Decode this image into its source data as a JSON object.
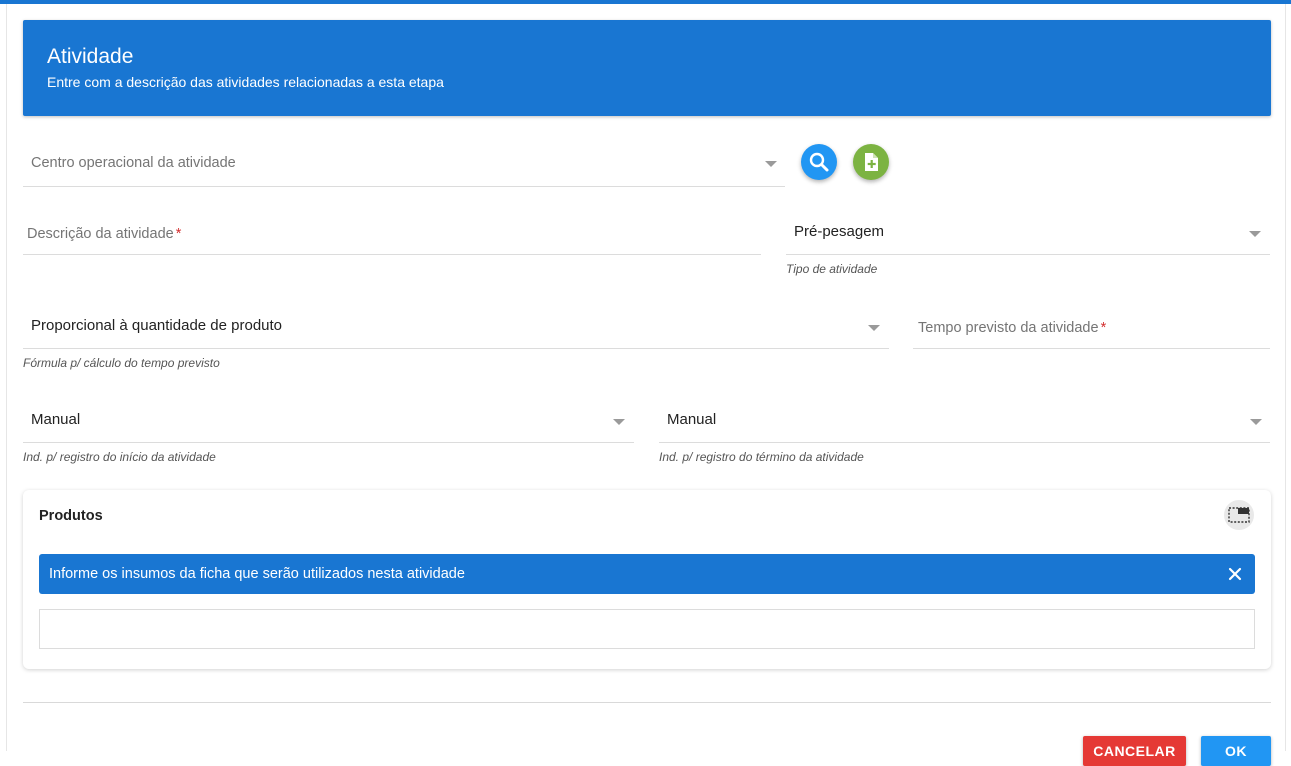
{
  "header": {
    "title": "Atividade",
    "subtitle": "Entre com a descrição das atividades relacionadas a esta etapa"
  },
  "fields": {
    "centro_operacional": {
      "placeholder": "Centro operacional da atividade"
    },
    "descricao": {
      "placeholder": "Descrição da atividade",
      "required_mark": "*"
    },
    "tipo_atividade": {
      "value": "Pré-pesagem",
      "hint": "Tipo de atividade"
    },
    "formula": {
      "value": "Proporcional à quantidade de produto",
      "hint": "Fórmula p/ cálculo do tempo previsto"
    },
    "tempo_previsto": {
      "placeholder": "Tempo previsto da atividade",
      "required_mark": "*"
    },
    "ind_inicio": {
      "value": "Manual",
      "hint": "Ind. p/ registro do início da atividade"
    },
    "ind_termino": {
      "value": "Manual",
      "hint": "Ind. p/ registro do término da atividade"
    }
  },
  "icons": {
    "search_button": "search-icon",
    "new_button": "add-document-icon",
    "toggle": "fullscreen-toggle-icon",
    "alert_close": "close-icon"
  },
  "produtos": {
    "title": "Produtos",
    "alert_text": "Informe os insumos da ficha que serão utilizados nesta atividade"
  },
  "actions": {
    "cancel_label": "CANCELAR",
    "ok_label": "OK"
  },
  "colors": {
    "primary": "#1976d2",
    "search_button": "#2196f3",
    "new_button": "#7cb342",
    "cancel": "#e53935",
    "ok": "#2196f3",
    "required": "#d32f2f"
  }
}
